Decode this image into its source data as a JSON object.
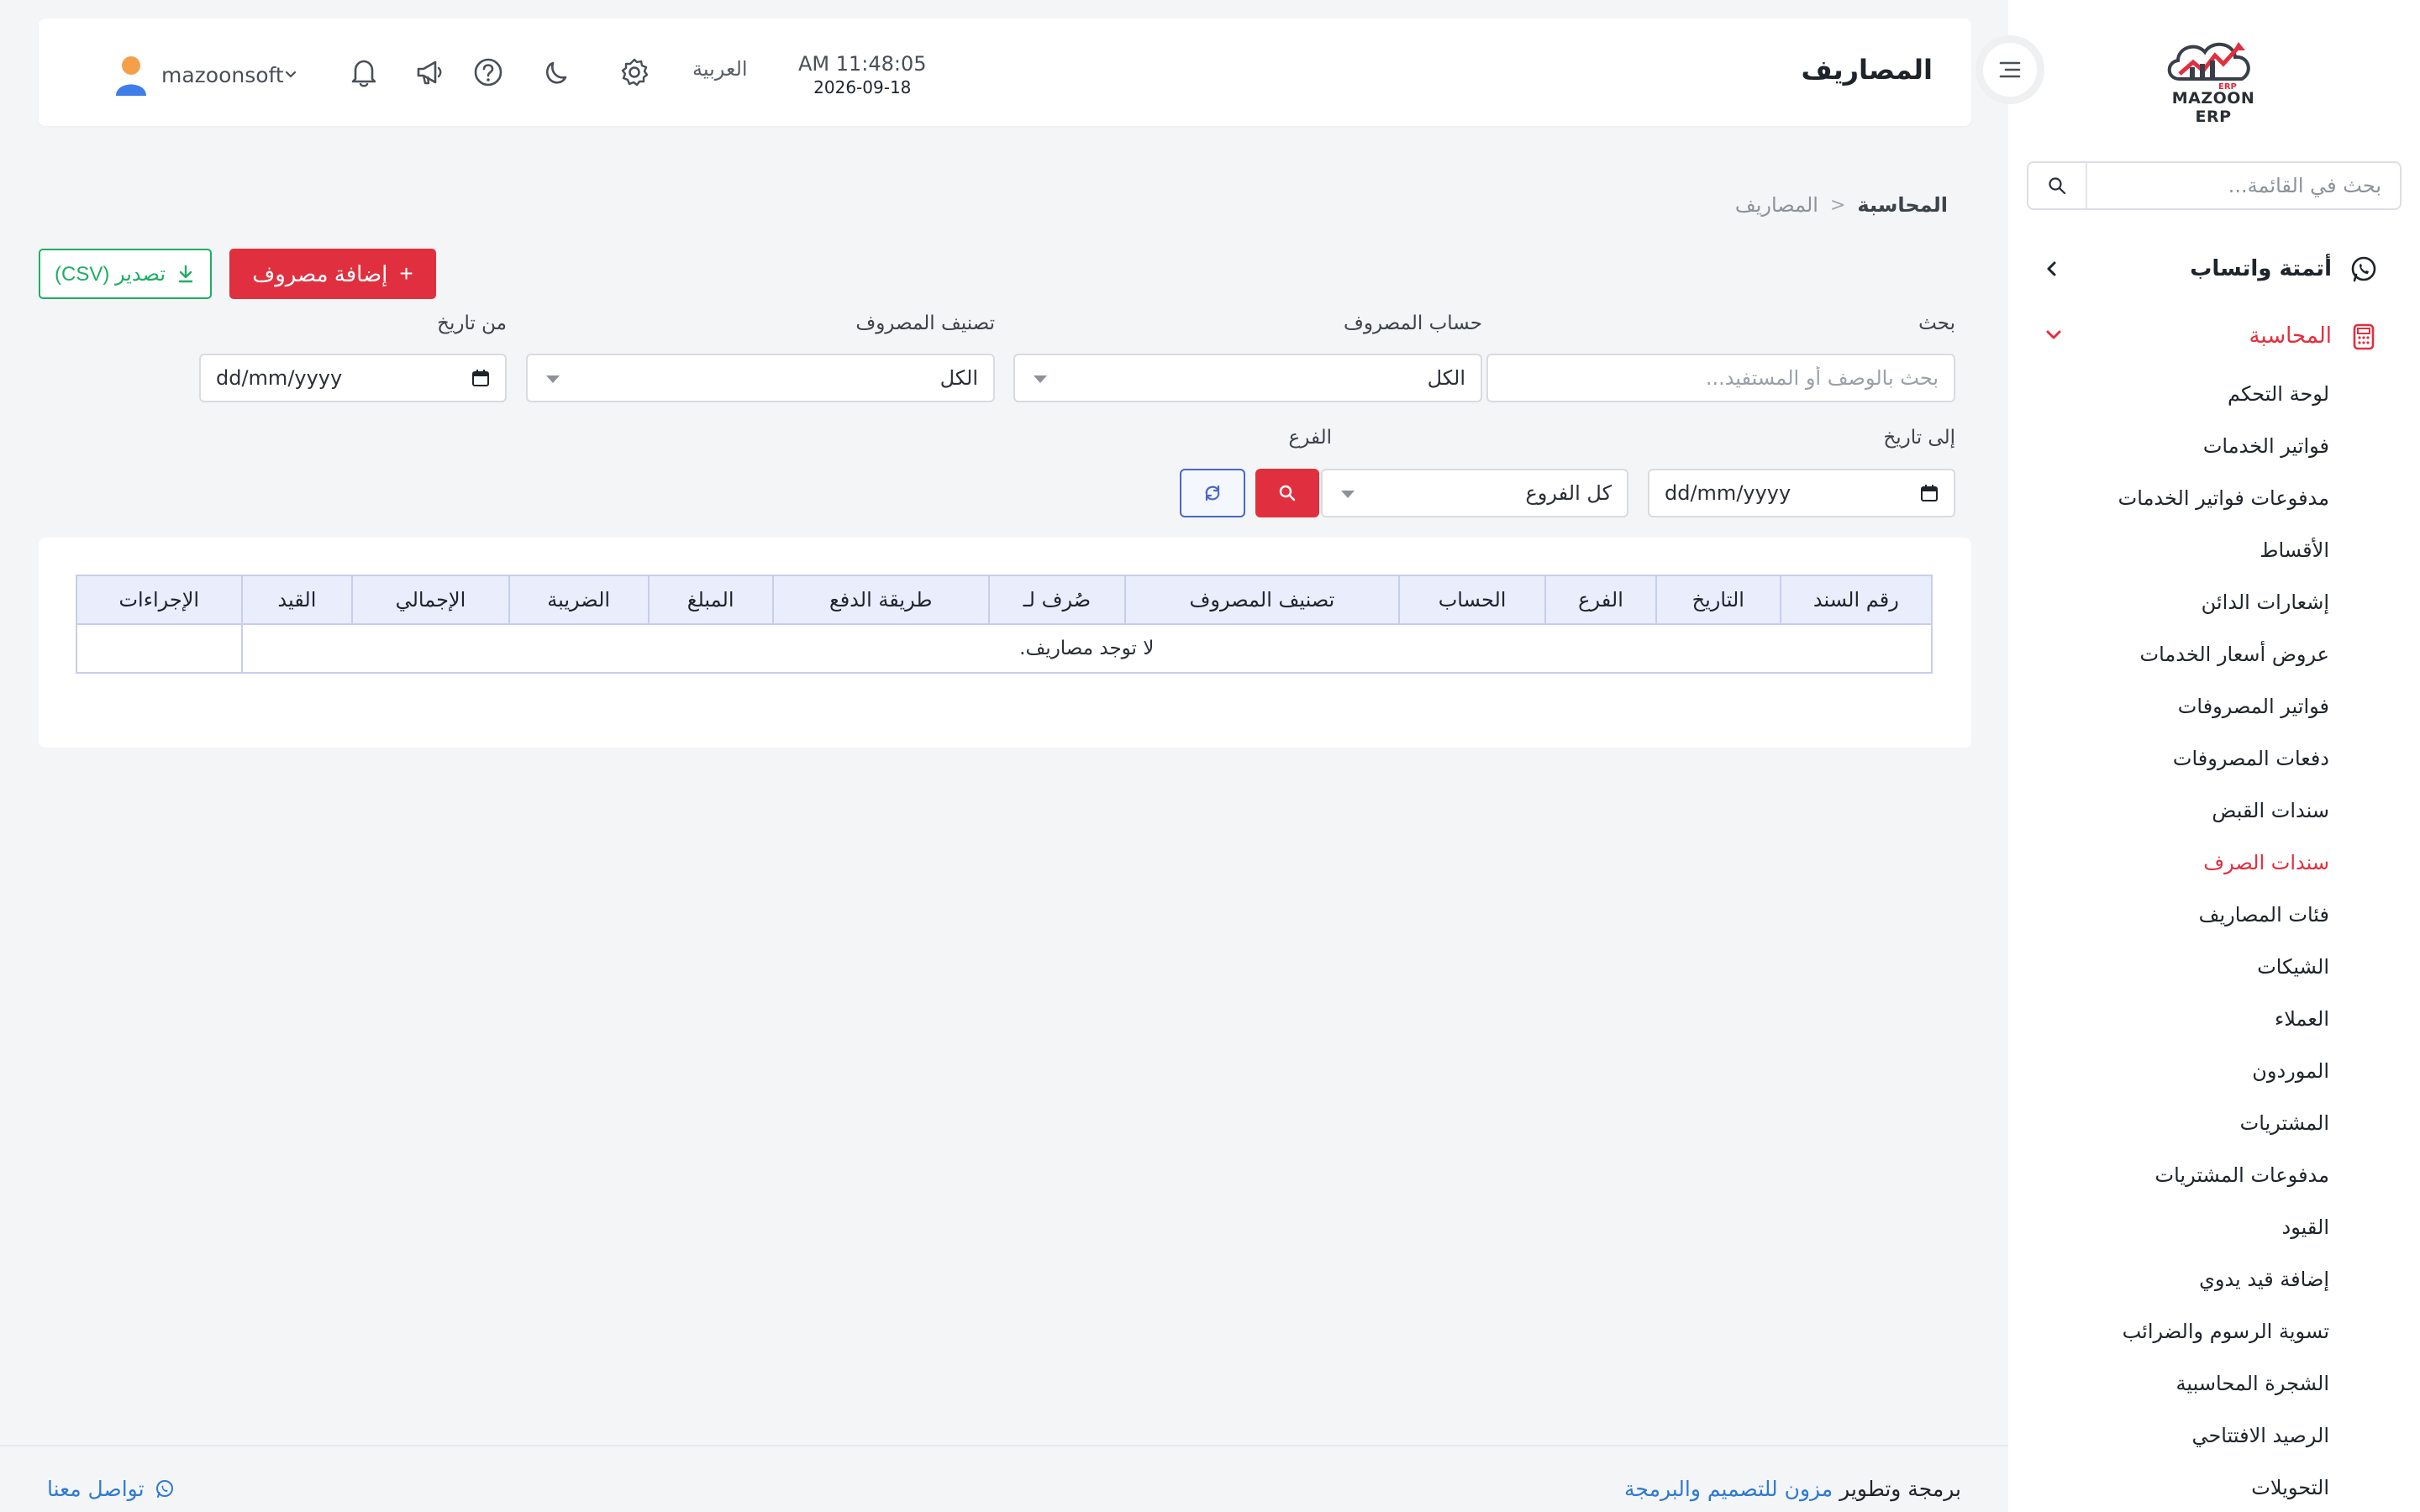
{
  "brand": {
    "name": "MAZOON ERP",
    "sub": "ERP"
  },
  "sidebar": {
    "search_placeholder": "بحث في القائمة...",
    "groups": [
      {
        "label": "أتمتة واتساب",
        "icon": "whatsapp-icon"
      },
      {
        "label": "المحاسبة",
        "icon": "calculator-icon"
      }
    ],
    "items": [
      {
        "label": "لوحة التحكم"
      },
      {
        "label": "فواتير الخدمات"
      },
      {
        "label": "مدفوعات فواتير الخدمات"
      },
      {
        "label": "الأقساط"
      },
      {
        "label": "إشعارات الدائن"
      },
      {
        "label": "عروض أسعار الخدمات"
      },
      {
        "label": "فواتير المصروفات"
      },
      {
        "label": "دفعات المصروفات"
      },
      {
        "label": "سندات القبض"
      },
      {
        "label": "سندات الصرف",
        "active": true
      },
      {
        "label": "فئات المصاريف"
      },
      {
        "label": "الشيكات"
      },
      {
        "label": "العملاء"
      },
      {
        "label": "الموردون"
      },
      {
        "label": "المشتريات"
      },
      {
        "label": "مدفوعات المشتريات"
      },
      {
        "label": "القيود"
      },
      {
        "label": "إضافة قيد يدوي"
      },
      {
        "label": "تسوية الرسوم والضرائب"
      },
      {
        "label": "الشجرة المحاسبية"
      },
      {
        "label": "الرصيد الافتتاحي"
      },
      {
        "label": "التحويلات"
      }
    ]
  },
  "header": {
    "title": "المصاريف",
    "time": "AM 11:48:05",
    "date": "2026-09-18",
    "language": "العربية",
    "username": "mazoonsoft"
  },
  "breadcrumb": {
    "root": "المحاسبة",
    "separator": "<",
    "current": "المصاريف"
  },
  "actions": {
    "add_label": "إضافة مصروف",
    "add_icon": "+",
    "export_label": "تصدير (CSV)"
  },
  "filters": {
    "search_label": "بحث",
    "search_placeholder": "بحث بالوصف أو المستفيد...",
    "account_label": "حساب المصروف",
    "account_value": "الكل",
    "category_label": "تصنيف المصروف",
    "category_value": "الكل",
    "from_date_label": "من تاريخ",
    "from_date_value": "dd/mm/yyyy",
    "to_date_label": "إلى تاريخ",
    "to_date_value": "dd/mm/yyyy",
    "branch_label": "الفرع",
    "branch_value": "كل الفروع"
  },
  "table": {
    "columns": [
      "رقم السند",
      "التاريخ",
      "الفرع",
      "الحساب",
      "تصنيف المصروف",
      "صُرف لـ",
      "طريقة الدفع",
      "المبلغ",
      "الضريبة",
      "الإجمالي",
      "القيد",
      "الإجراءات"
    ],
    "empty_message": "لا توجد مصاريف."
  },
  "footer": {
    "credit_prefix": "برمجة وتطوير",
    "credit_link": "مزون للتصميم والبرمجة",
    "contact": "تواصل معنا"
  },
  "colors": {
    "accent": "#e0303f",
    "success": "#1fae63",
    "link": "#2f7ad0",
    "table_header": "#eaedfc"
  }
}
